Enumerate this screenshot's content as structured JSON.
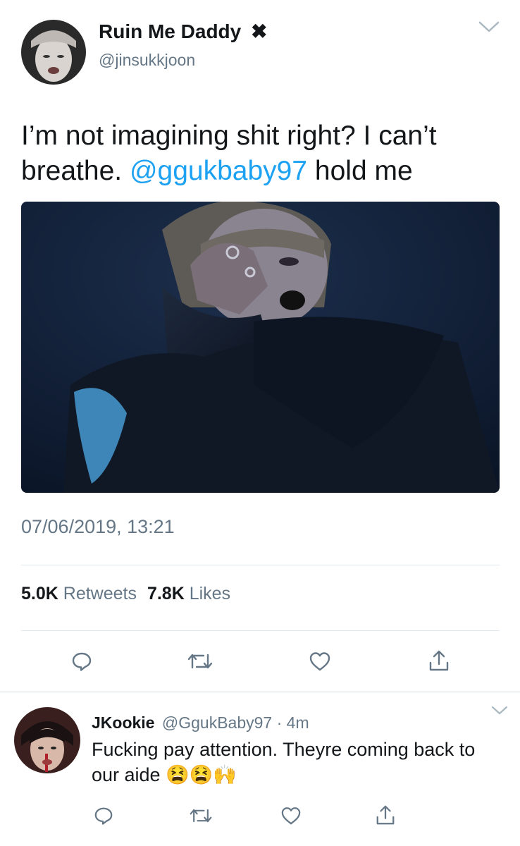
{
  "main_tweet": {
    "display_name": "Ruin Me Daddy",
    "name_emoji": "✖",
    "handle": "@jinsukkjoon",
    "text_part1": "I’m not imagining shit right? I can’t breathe.",
    "mention": "@ggukbaby97",
    "text_part2": "hold me",
    "timestamp": "07/06/2019, 13:21",
    "retweets_count": "5.0K",
    "retweets_label": "Retweets",
    "likes_count": "7.8K",
    "likes_label": "Likes",
    "icons": [
      "reply-icon",
      "retweet-icon",
      "like-icon",
      "share-icon"
    ]
  },
  "reply_tweet": {
    "display_name": "JKookie",
    "handle": "@GgukBaby97",
    "separator": "·",
    "time_ago": "4m",
    "text": "Fucking pay attention. Theyre coming back to our aide",
    "emojis": "😫😫🙌",
    "icons": [
      "reply-icon",
      "retweet-icon",
      "like-icon",
      "share-icon"
    ]
  },
  "colors": {
    "link": "#1da1f2",
    "muted": "#657786",
    "divider": "#e1e8ed",
    "photo_bg": "#0f1a2e"
  }
}
